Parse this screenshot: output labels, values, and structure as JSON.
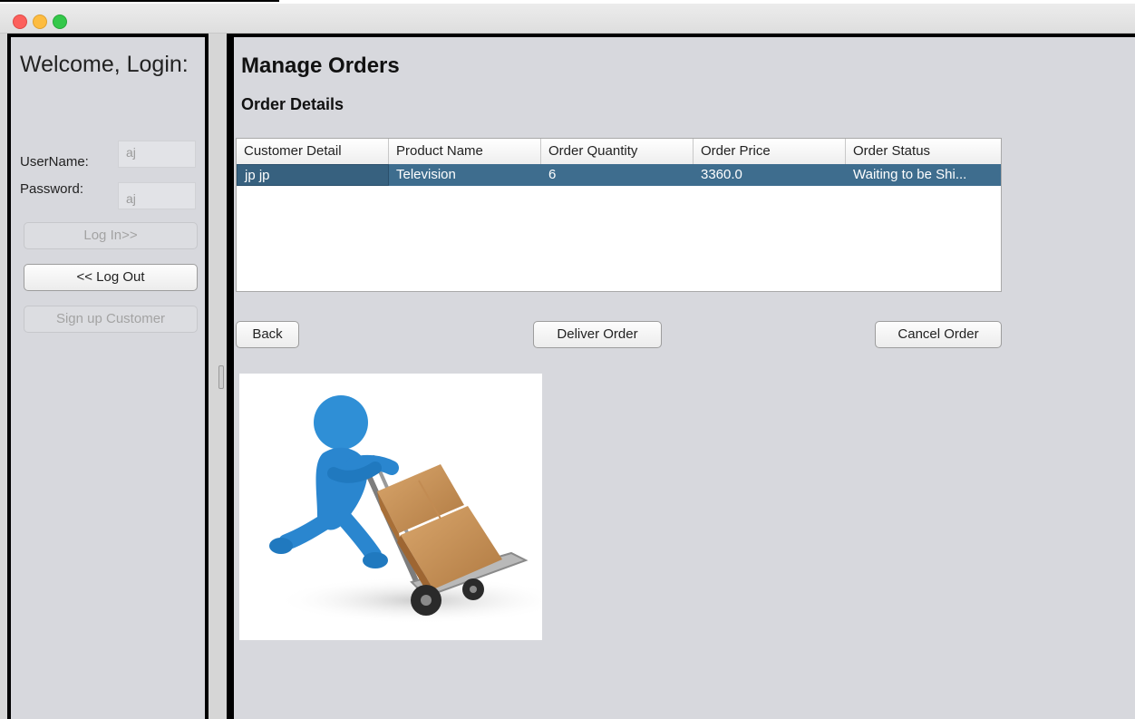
{
  "login": {
    "welcome": "Welcome, Login:",
    "username_label": "UserName:",
    "password_label": "Password:",
    "username_value": "aj",
    "password_value": "aj",
    "login_button": "Log In>>",
    "logout_button": "<< Log Out",
    "signup_button": "Sign up Customer"
  },
  "main": {
    "title": "Manage Orders",
    "subtitle": "Order Details",
    "columns": [
      "Customer Detail",
      "Product Name",
      "Order Quantity",
      "Order Price",
      "Order Status"
    ],
    "rows": [
      [
        "jp jp",
        "Television",
        "6",
        "3360.0",
        "Waiting to be Shi..."
      ]
    ],
    "back_button": "Back",
    "deliver_button": "Deliver Order",
    "cancel_button": "Cancel Order"
  },
  "colors": {
    "selected_row": "#3e6d8e",
    "panel_bg": "#d7d8dd"
  }
}
